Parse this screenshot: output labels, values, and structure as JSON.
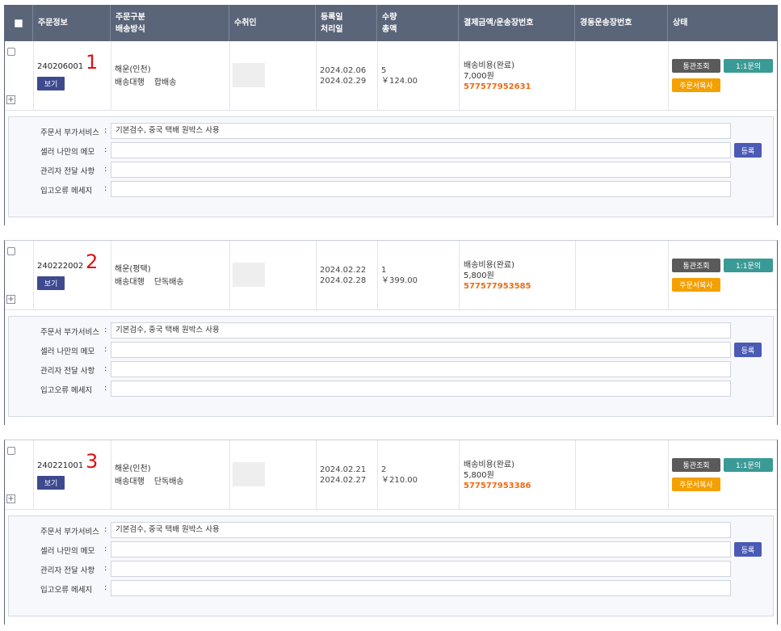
{
  "header": {
    "col_order_info": "주문정보",
    "col_type_line1": "주문구분",
    "col_type_line2": "배송방식",
    "col_recipient": "수취인",
    "col_date_line1": "등록일",
    "col_date_line2": "처리일",
    "col_qty_line1": "수량",
    "col_qty_line2": "총액",
    "col_payment": "결제금액/운송장번호",
    "col_tracking": "경동운송장번호",
    "col_status": "상태"
  },
  "labels": {
    "view_button": "보기",
    "customs_button": "통관조회",
    "inquiry_button": "1:1문의",
    "copy_button": "주문서복사",
    "register_button": "등록",
    "extra_service": "주문서 부가서비스",
    "seller_memo": "셀러 나만의 메모",
    "admin_note": "관리자 전달 사항",
    "error_message": "입고오류 메세지",
    "colon": ":",
    "expand": "+"
  },
  "orders": [
    {
      "order_no": "240206001",
      "marker": "1",
      "order_type": "해운(인천)",
      "shipping_main": "배송대행",
      "shipping_sub": "합배송",
      "registered": "2024.02.06",
      "processed": "2024.02.29",
      "qty": "5",
      "total": "￥124.00",
      "payment_label": "배송비용(완료)",
      "payment_amount": "7,000원",
      "tracking_no": "577577952631",
      "extra_service_value": "기본검수, 중국 택배 원박스 사용"
    },
    {
      "order_no": "240222002",
      "marker": "2",
      "order_type": "해운(평택)",
      "shipping_main": "배송대행",
      "shipping_sub": "단독배송",
      "registered": "2024.02.22",
      "processed": "2024.02.28",
      "qty": "1",
      "total": "￥399.00",
      "payment_label": "배송비용(완료)",
      "payment_amount": "5,800원",
      "tracking_no": "577577953585",
      "extra_service_value": "기본검수, 중국 택배 원박스 사용"
    },
    {
      "order_no": "240221001",
      "marker": "3",
      "order_type": "해운(인천)",
      "shipping_main": "배송대행",
      "shipping_sub": "단독배송",
      "registered": "2024.02.21",
      "processed": "2024.02.27",
      "qty": "2",
      "total": "￥210.00",
      "payment_label": "배송비용(완료)",
      "payment_amount": "5,800원",
      "tracking_no": "577577953386",
      "extra_service_value": "기본검수, 중국 택배 원박스 사용"
    }
  ]
}
